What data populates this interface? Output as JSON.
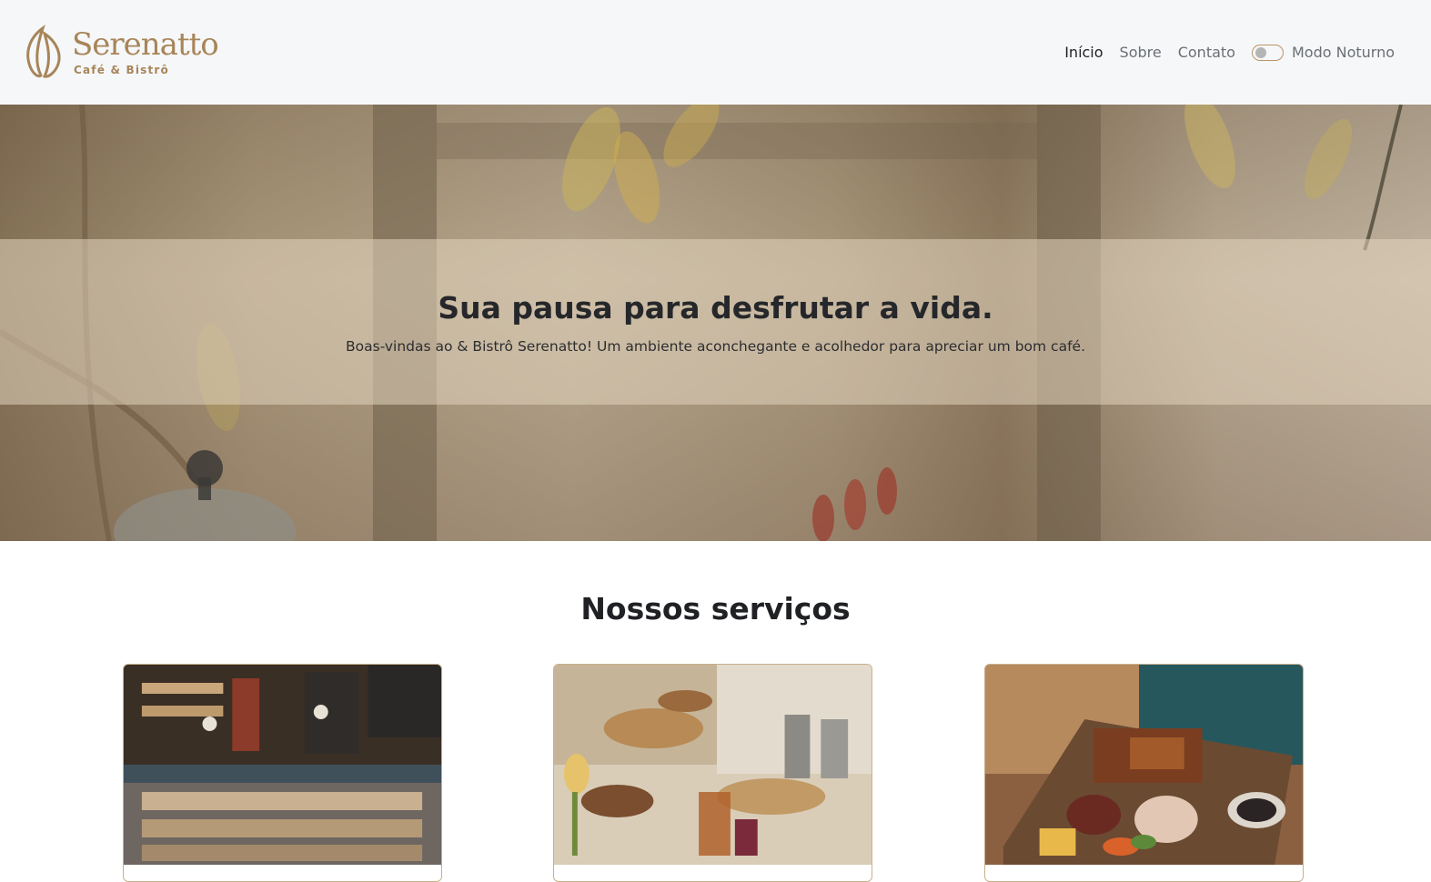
{
  "header": {
    "logo": {
      "name": "Serenatto",
      "subtitle": "Café & Bistrô"
    },
    "nav": [
      {
        "label": "Início",
        "active": true
      },
      {
        "label": "Sobre",
        "active": false
      },
      {
        "label": "Contato",
        "active": false
      }
    ],
    "dark_mode": {
      "label": "Modo Noturno",
      "enabled": false
    }
  },
  "hero": {
    "title": "Sua pausa para desfrutar a vida.",
    "subtitle": "Boas-vindas ao & Bistrô Serenatto! Um ambiente aconchegante e acolhedor para apreciar um bom café."
  },
  "services": {
    "title": "Nossos serviços",
    "cards": [
      {
        "image": "cafe-counter-photo"
      },
      {
        "image": "breakfast-buffet-photo"
      },
      {
        "image": "charcuterie-board-photo"
      }
    ]
  },
  "colors": {
    "brand": "#a78559",
    "header_bg": "#f6f7f9",
    "text_dark": "#1f2124",
    "text_muted": "#6b6f74"
  }
}
